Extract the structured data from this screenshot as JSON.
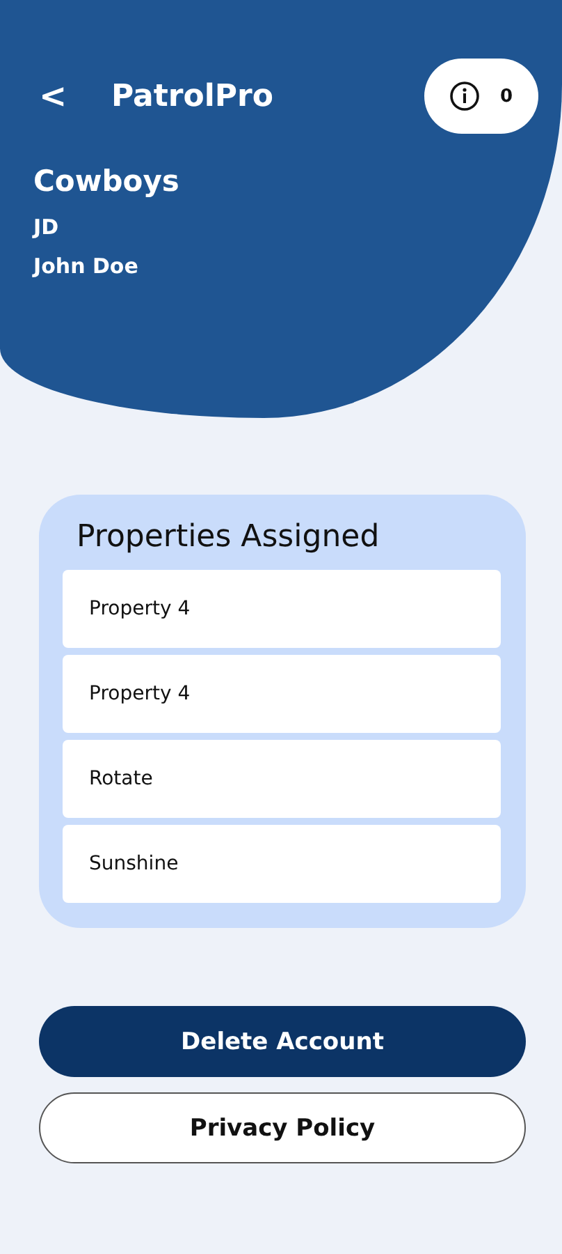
{
  "header": {
    "back_label": "<",
    "title": "PatrolPro",
    "info_count": "0",
    "team": "Cowboys",
    "initials": "JD",
    "user_name": "John Doe"
  },
  "properties_card": {
    "title": "Properties Assigned",
    "items": [
      {
        "label": "Property 4"
      },
      {
        "label": "Property 4"
      },
      {
        "label": "Rotate"
      },
      {
        "label": "Sunshine"
      }
    ]
  },
  "buttons": [
    {
      "label": "Delete Account",
      "kind": "primary"
    },
    {
      "label": "Privacy Policy",
      "kind": "outline"
    }
  ]
}
